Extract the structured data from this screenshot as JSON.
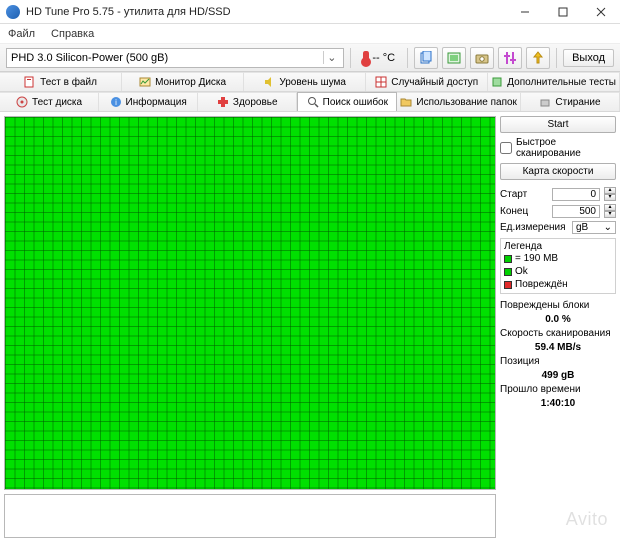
{
  "window": {
    "title": "HD Tune Pro 5.75 - утилита для HD/SSD"
  },
  "menu": {
    "file": "Файл",
    "help": "Справка"
  },
  "toolbar": {
    "drive": "PHD 3.0 Silicon-Power (500 gB)",
    "temp": "-- °C",
    "exit": "Выход"
  },
  "icons": {
    "copy": "copy-icon",
    "screenshot": "screenshot-icon",
    "camera": "camera-icon",
    "settings": "settings-icon",
    "save": "save-icon"
  },
  "tabs1": [
    {
      "id": "file-test",
      "label": "Тест в файл"
    },
    {
      "id": "disk-monitor",
      "label": "Монитор Диска"
    },
    {
      "id": "noise",
      "label": "Уровень шума"
    },
    {
      "id": "random",
      "label": "Случайный доступ"
    },
    {
      "id": "extra",
      "label": "Дополнительные тесты"
    }
  ],
  "tabs2": [
    {
      "id": "disk-test",
      "label": "Тест диска"
    },
    {
      "id": "info",
      "label": "Информация"
    },
    {
      "id": "health",
      "label": "Здоровье"
    },
    {
      "id": "error-scan",
      "label": "Поиск ошибок",
      "active": true
    },
    {
      "id": "folder-usage",
      "label": "Использование папок"
    },
    {
      "id": "erase",
      "label": "Стирание"
    }
  ],
  "right": {
    "start": "Start",
    "quick": "Быстрое сканирование",
    "speedmap": "Карта скорости",
    "start_lbl": "Старт",
    "start_val": "0",
    "end_lbl": "Конец",
    "end_val": "500",
    "unit_lbl": "Ед.измерения",
    "unit_val": "gB",
    "legend_title": "Легенда",
    "leg_size": "= 190 MB",
    "leg_ok": "Ok",
    "leg_bad": "Повреждён",
    "stats": {
      "damaged_lbl": "Повреждены блоки",
      "damaged_val": "0.0 %",
      "speed_lbl": "Скорость сканирования",
      "speed_val": "59.4 MB/s",
      "pos_lbl": "Позиция",
      "pos_val": "499 gB",
      "time_lbl": "Прошло времени",
      "time_val": "1:40:10"
    }
  },
  "watermark": "Avito"
}
